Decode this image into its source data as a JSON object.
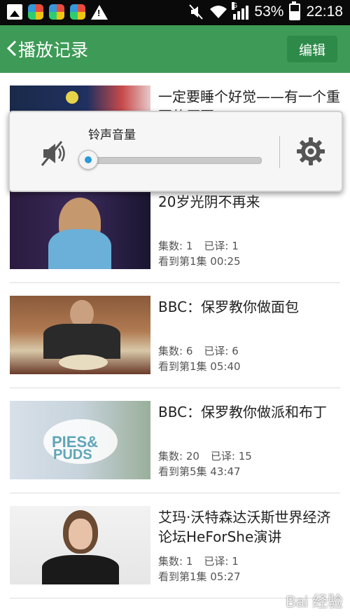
{
  "status_bar": {
    "battery": "53%",
    "time": "22:18",
    "network": "G"
  },
  "header": {
    "title": "播放记录",
    "edit_label": "编辑"
  },
  "volume_popup": {
    "label": "铃声音量",
    "level": 0.0
  },
  "items": [
    {
      "title": "一定要睡个好觉——有一个重要的原因！",
      "episodes_label": "",
      "translated_label": "",
      "progress_label": ""
    },
    {
      "title": "20岁光阴不再来",
      "episodes_label": "集数: 1",
      "translated_label": "已译: 1",
      "progress_label": "看到第1集 00:25"
    },
    {
      "title": "BBC：保罗教你做面包",
      "episodes_label": "集数: 6",
      "translated_label": "已译: 6",
      "progress_label": "看到第1集 05:40"
    },
    {
      "title": "BBC：保罗教你做派和布丁",
      "episodes_label": "集数: 20",
      "translated_label": "已译: 15",
      "progress_label": "看到第5集 43:47"
    },
    {
      "title": "艾玛·沃特森达沃斯世界经济论坛HeForShe演讲",
      "episodes_label": "集数: 1",
      "translated_label": "已译: 1",
      "progress_label": "看到第1集 05:27"
    }
  ],
  "watermark": "Bai 经验"
}
